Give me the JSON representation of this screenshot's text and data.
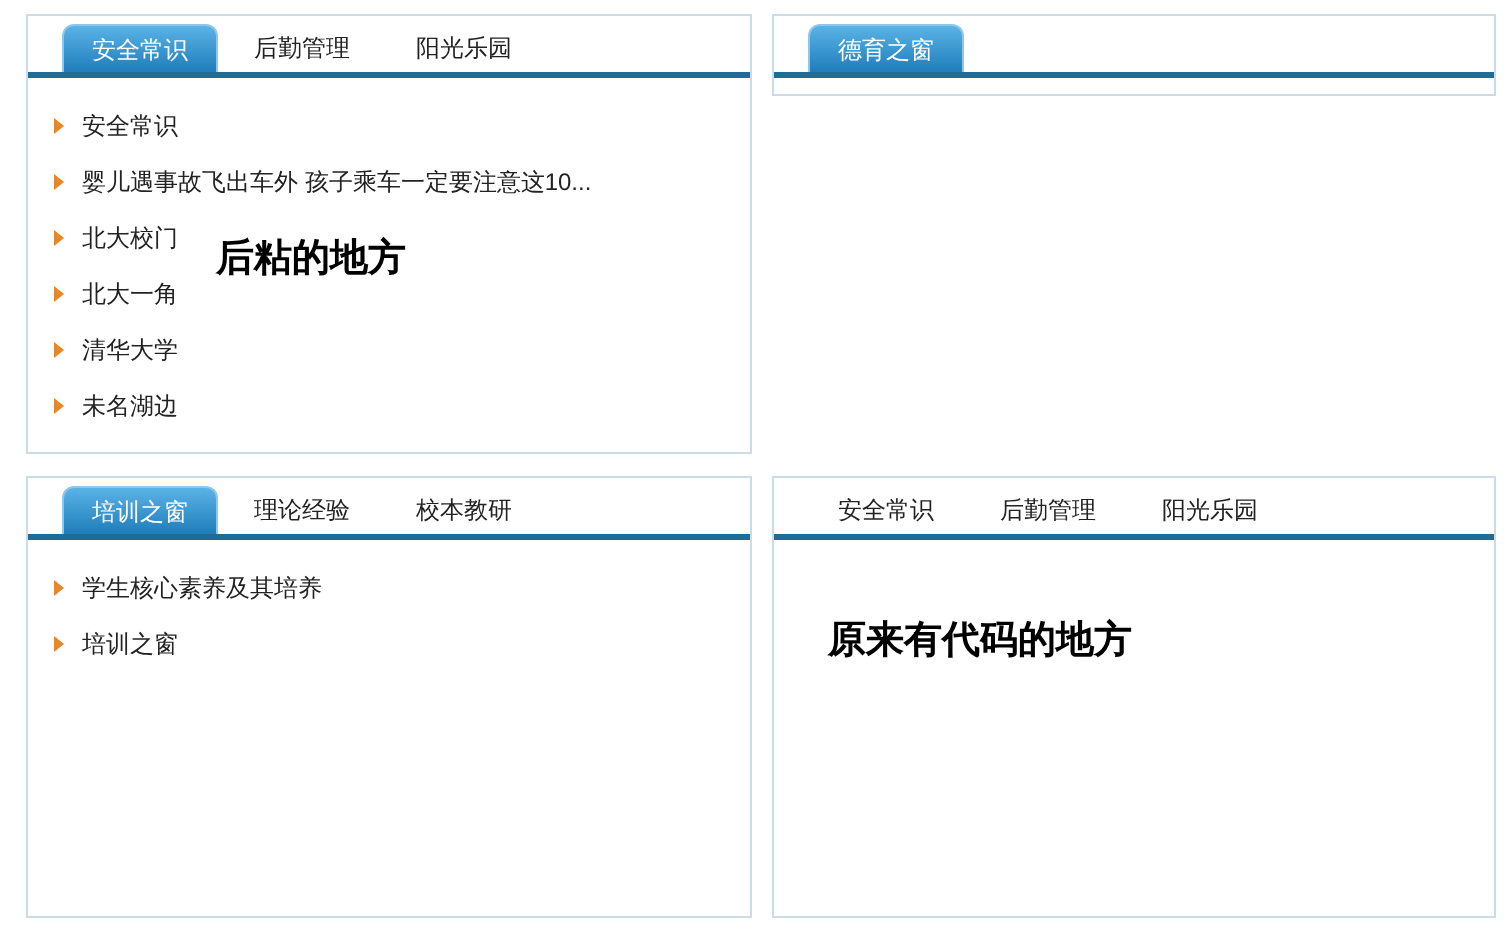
{
  "panels": [
    {
      "tabs": [
        {
          "label": "安全常识",
          "selected": true
        },
        {
          "label": "后勤管理",
          "selected": false
        },
        {
          "label": "阳光乐园",
          "selected": false
        }
      ],
      "items": [
        "安全常识",
        "婴儿遇事故飞出车外 孩子乘车一定要注意这10...",
        "北大校门",
        "北大一角",
        "清华大学",
        "未名湖边"
      ],
      "note": "后粘的地方"
    },
    {
      "tabs": [
        {
          "label": "德育之窗",
          "selected": true
        }
      ]
    },
    {
      "tabs": [
        {
          "label": "培训之窗",
          "selected": true
        },
        {
          "label": "理论经验",
          "selected": false
        },
        {
          "label": "校本教研",
          "selected": false
        }
      ],
      "items": [
        "学生核心素养及其培养",
        "培训之窗"
      ]
    },
    {
      "tabs": [
        {
          "label": "安全常识",
          "selected": false
        },
        {
          "label": "后勤管理",
          "selected": false
        },
        {
          "label": "阳光乐园",
          "selected": false
        }
      ],
      "note": "原来有代码的地方"
    }
  ]
}
